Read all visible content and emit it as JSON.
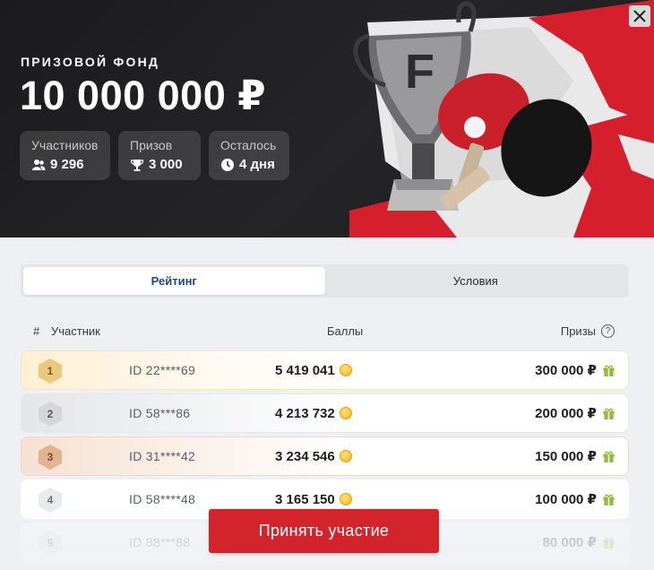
{
  "header": {
    "fund_label": "ПРИЗОВОЙ ФОНД",
    "fund_amount": "10 000 000 ₽",
    "stats": [
      {
        "label": "Участников",
        "value": "9 296",
        "icon": "users-icon"
      },
      {
        "label": "Призов",
        "value": "3 000",
        "icon": "trophy-icon"
      },
      {
        "label": "Осталось",
        "value": "4 дня",
        "icon": "clock-icon"
      }
    ],
    "close_icon": "close-icon"
  },
  "tabs": [
    {
      "label": "Рейтинг",
      "active": true
    },
    {
      "label": "Условия",
      "active": false
    }
  ],
  "table": {
    "headers": {
      "hash": "#",
      "participant": "Участник",
      "points": "Баллы",
      "prizes": "Призы",
      "help": "?"
    },
    "rows": [
      {
        "rank": "1",
        "id": "ID 22****69",
        "points": "5 419 041",
        "prize": "300 000 ₽"
      },
      {
        "rank": "2",
        "id": "ID 58***86",
        "points": "4 213 732",
        "prize": "200 000 ₽"
      },
      {
        "rank": "3",
        "id": "ID 31****42",
        "points": "3 234 546",
        "prize": "150 000 ₽"
      },
      {
        "rank": "4",
        "id": "ID 58****48",
        "points": "3 165 150",
        "prize": "100 000 ₽"
      },
      {
        "rank": "5",
        "id": "ID 88***88",
        "points": "",
        "prize": "80 000 ₽"
      }
    ]
  },
  "cta": {
    "label": "Принять участие"
  },
  "colors": {
    "accent": "#d2242a",
    "tab_active_text": "#1f4a7c",
    "coin": "#f3b21b",
    "gift": "#8fbf3a"
  }
}
